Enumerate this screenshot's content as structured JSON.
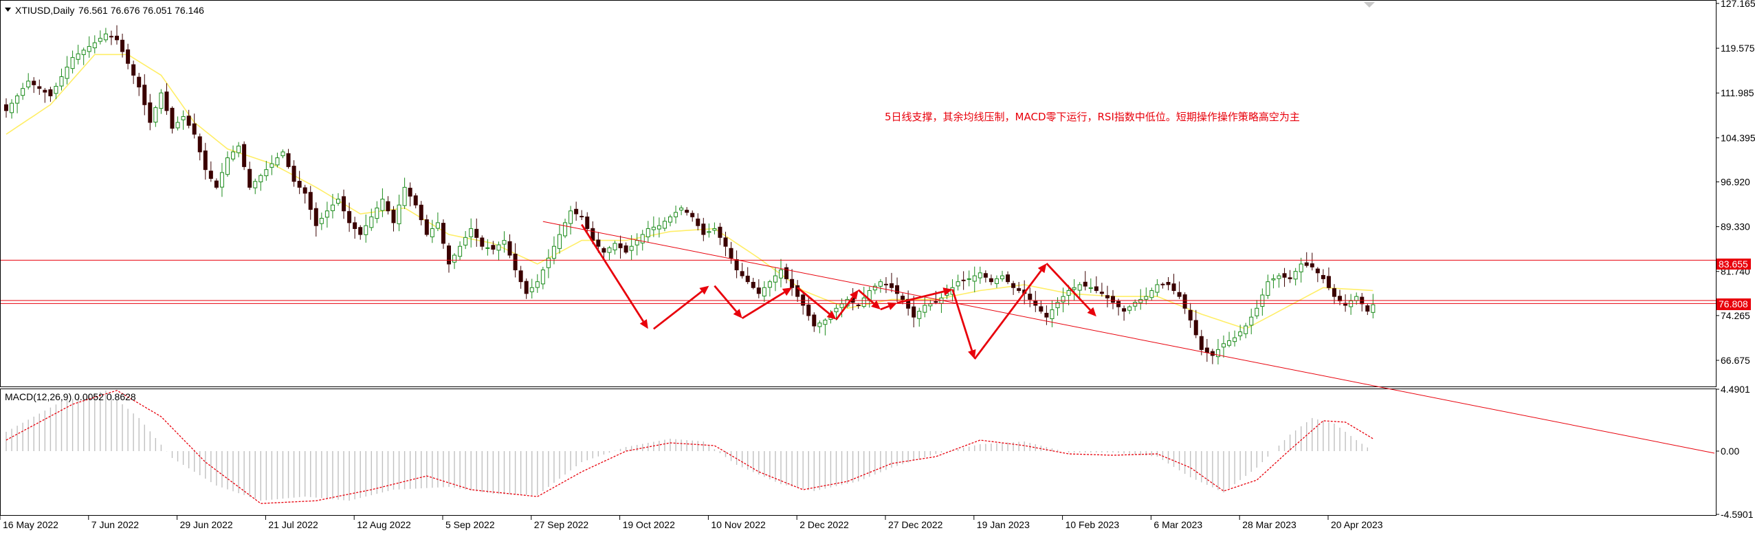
{
  "header": {
    "symbol_label": "XTIUSD,Daily",
    "ohlc_label": "76.561 76.676 76.051 76.146"
  },
  "annotation": "5日线支撑，其余均线压制，MACD零下运行，RSI指数中低位。短期操作操作策略高空为主",
  "macd": {
    "label": "MACD(12,26,9) 0.0052 0.8628",
    "ticks": [
      "4.4901",
      "0.00",
      "-4.5901"
    ],
    "tick_values": [
      4.4901,
      0,
      -4.5901
    ]
  },
  "colors": {
    "bull_candle": "#1a8a1a",
    "bear_candle": "#3a0000",
    "ma_line": "#ffee66",
    "red": "#e8000b",
    "grid_axis": "#000000",
    "macd_hist": "#c0c0c0"
  },
  "price_labels": {
    "resistance": "83.655",
    "current": "76.808"
  },
  "chart_data": {
    "type": "candlestick",
    "title": "XTIUSD,Daily",
    "y_ticks": [
      "127.165",
      "119.575",
      "111.985",
      "104.395",
      "96.920",
      "89.330",
      "81.740",
      "74.265",
      "66.675"
    ],
    "y_tick_values": [
      127.165,
      119.575,
      111.985,
      104.395,
      96.92,
      89.33,
      81.74,
      74.265,
      66.675
    ],
    "ylim": [
      62.5,
      127.2
    ],
    "x_ticks": [
      "16 May 2022",
      "7 Jun 2022",
      "29 Jun 2022",
      "21 Jul 2022",
      "12 Aug 2022",
      "5 Sep 2022",
      "27 Sep 2022",
      "19 Oct 2022",
      "10 Nov 2022",
      "2 Dec 2022",
      "27 Dec 2022",
      "19 Jan 2023",
      "10 Feb 2023",
      "6 Mar 2023",
      "28 Mar 2023",
      "20 Apr 2023"
    ],
    "x_tick_index": [
      0,
      16,
      32,
      48,
      64,
      80,
      96,
      112,
      128,
      144,
      160,
      176,
      192,
      208,
      224,
      240
    ],
    "close_anchors": [
      [
        0,
        109.0
      ],
      [
        4,
        114.0
      ],
      [
        8,
        111.5
      ],
      [
        12,
        118.0
      ],
      [
        16,
        120.5
      ],
      [
        18,
        122.0
      ],
      [
        20,
        121.0
      ],
      [
        22,
        117.0
      ],
      [
        24,
        113.0
      ],
      [
        26,
        107.0
      ],
      [
        28,
        112.0
      ],
      [
        30,
        106.0
      ],
      [
        32,
        108.0
      ],
      [
        34,
        105.0
      ],
      [
        36,
        99.0
      ],
      [
        38,
        96.0
      ],
      [
        40,
        101.0
      ],
      [
        42,
        103.0
      ],
      [
        44,
        96.0
      ],
      [
        46,
        98.0
      ],
      [
        48,
        100.0
      ],
      [
        50,
        102.0
      ],
      [
        52,
        97.0
      ],
      [
        54,
        95.0
      ],
      [
        56,
        89.5
      ],
      [
        58,
        92.0
      ],
      [
        60,
        94.0
      ],
      [
        62,
        90.0
      ],
      [
        64,
        88.0
      ],
      [
        66,
        91.0
      ],
      [
        68,
        94.0
      ],
      [
        70,
        90.0
      ],
      [
        72,
        96.0
      ],
      [
        74,
        93.0
      ],
      [
        76,
        88.0
      ],
      [
        78,
        90.0
      ],
      [
        80,
        83.0
      ],
      [
        82,
        86.0
      ],
      [
        84,
        89.0
      ],
      [
        86,
        86.0
      ],
      [
        88,
        85.5
      ],
      [
        90,
        87.0
      ],
      [
        92,
        82.0
      ],
      [
        94,
        78.0
      ],
      [
        96,
        80.0
      ],
      [
        98,
        84.0
      ],
      [
        100,
        88.0
      ],
      [
        102,
        92.0
      ],
      [
        104,
        91.0
      ],
      [
        106,
        87.0
      ],
      [
        108,
        85.0
      ],
      [
        110,
        86.5
      ],
      [
        112,
        85.0
      ],
      [
        114,
        87.0
      ],
      [
        116,
        89.0
      ],
      [
        118,
        89.5
      ],
      [
        120,
        91.0
      ],
      [
        122,
        92.5
      ],
      [
        124,
        91.0
      ],
      [
        126,
        88.0
      ],
      [
        128,
        89.0
      ],
      [
        130,
        86.0
      ],
      [
        132,
        82.0
      ],
      [
        134,
        80.0
      ],
      [
        136,
        78.0
      ],
      [
        138,
        80.0
      ],
      [
        140,
        82.0
      ],
      [
        142,
        79.0
      ],
      [
        144,
        76.0
      ],
      [
        146,
        72.5
      ],
      [
        148,
        73.5
      ],
      [
        150,
        75.5
      ],
      [
        152,
        77.0
      ],
      [
        154,
        76.0
      ],
      [
        156,
        78.5
      ],
      [
        158,
        80.0
      ],
      [
        160,
        79.0
      ],
      [
        162,
        77.0
      ],
      [
        164,
        74.0
      ],
      [
        166,
        76.0
      ],
      [
        168,
        76.5
      ],
      [
        170,
        78.0
      ],
      [
        172,
        80.0
      ],
      [
        174,
        80.5
      ],
      [
        176,
        81.5
      ],
      [
        178,
        80.0
      ],
      [
        180,
        81.0
      ],
      [
        182,
        79.0
      ],
      [
        184,
        78.0
      ],
      [
        186,
        76.0
      ],
      [
        188,
        74.0
      ],
      [
        190,
        76.5
      ],
      [
        192,
        78.5
      ],
      [
        194,
        79.5
      ],
      [
        196,
        79.0
      ],
      [
        198,
        78.0
      ],
      [
        200,
        76.5
      ],
      [
        202,
        75.0
      ],
      [
        204,
        76.5
      ],
      [
        206,
        77.5
      ],
      [
        208,
        79.5
      ],
      [
        210,
        79.5
      ],
      [
        212,
        77.5
      ],
      [
        214,
        73.5
      ],
      [
        216,
        68.5
      ],
      [
        218,
        67.5
      ],
      [
        220,
        69.5
      ],
      [
        222,
        70.5
      ],
      [
        224,
        72.5
      ],
      [
        226,
        75.5
      ],
      [
        228,
        80.0
      ],
      [
        230,
        81.0
      ],
      [
        232,
        80.5
      ],
      [
        234,
        83.0
      ],
      [
        236,
        82.5
      ],
      [
        238,
        80.5
      ],
      [
        240,
        77.5
      ],
      [
        242,
        76.0
      ],
      [
        244,
        77.5
      ],
      [
        246,
        75.0
      ],
      [
        247,
        76.1
      ]
    ],
    "ma_anchors": [
      [
        0,
        105.0
      ],
      [
        8,
        110.0
      ],
      [
        16,
        118.5
      ],
      [
        22,
        118.5
      ],
      [
        28,
        115.0
      ],
      [
        34,
        107.0
      ],
      [
        40,
        102.5
      ],
      [
        48,
        100.0
      ],
      [
        56,
        96.0
      ],
      [
        64,
        91.5
      ],
      [
        72,
        92.5
      ],
      [
        80,
        88.0
      ],
      [
        88,
        86.5
      ],
      [
        96,
        83.0
      ],
      [
        104,
        87.0
      ],
      [
        112,
        87.0
      ],
      [
        120,
        88.5
      ],
      [
        128,
        89.0
      ],
      [
        136,
        84.0
      ],
      [
        144,
        78.5
      ],
      [
        152,
        75.5
      ],
      [
        160,
        77.0
      ],
      [
        168,
        77.0
      ],
      [
        176,
        78.5
      ],
      [
        184,
        79.5
      ],
      [
        192,
        78.0
      ],
      [
        200,
        77.5
      ],
      [
        208,
        77.5
      ],
      [
        216,
        74.5
      ],
      [
        224,
        72.0
      ],
      [
        232,
        76.0
      ],
      [
        238,
        79.0
      ],
      [
        247,
        78.5
      ]
    ],
    "macd_hist_anchors": [
      [
        0,
        1.4
      ],
      [
        10,
        3.6
      ],
      [
        18,
        4.4
      ],
      [
        24,
        2.4
      ],
      [
        30,
        -0.5
      ],
      [
        38,
        -2.5
      ],
      [
        46,
        -3.6
      ],
      [
        54,
        -3.3
      ],
      [
        62,
        -3.6
      ],
      [
        70,
        -2.8
      ],
      [
        80,
        -2.6
      ],
      [
        88,
        -3.1
      ],
      [
        96,
        -3.2
      ],
      [
        104,
        -0.8
      ],
      [
        112,
        0.3
      ],
      [
        120,
        0.9
      ],
      [
        126,
        0.7
      ],
      [
        132,
        -1.0
      ],
      [
        140,
        -2.4
      ],
      [
        146,
        -2.9
      ],
      [
        154,
        -2.2
      ],
      [
        160,
        -1.2
      ],
      [
        168,
        -0.2
      ],
      [
        176,
        0.5
      ],
      [
        184,
        0.7
      ],
      [
        192,
        -0.1
      ],
      [
        200,
        -0.1
      ],
      [
        208,
        -0.4
      ],
      [
        214,
        -1.9
      ],
      [
        220,
        -3.0
      ],
      [
        226,
        -1.2
      ],
      [
        232,
        1.2
      ],
      [
        236,
        2.4
      ],
      [
        240,
        2.0
      ],
      [
        244,
        0.8
      ],
      [
        247,
        0.0
      ]
    ],
    "macd_signal_anchors": [
      [
        0,
        0.8
      ],
      [
        12,
        3.4
      ],
      [
        20,
        4.4
      ],
      [
        28,
        2.5
      ],
      [
        36,
        -0.8
      ],
      [
        46,
        -3.8
      ],
      [
        56,
        -3.6
      ],
      [
        66,
        -2.8
      ],
      [
        76,
        -1.8
      ],
      [
        84,
        -2.8
      ],
      [
        96,
        -3.3
      ],
      [
        104,
        -1.5
      ],
      [
        112,
        0.0
      ],
      [
        120,
        0.6
      ],
      [
        128,
        0.4
      ],
      [
        136,
        -1.5
      ],
      [
        144,
        -2.8
      ],
      [
        152,
        -2.2
      ],
      [
        160,
        -0.9
      ],
      [
        168,
        -0.4
      ],
      [
        176,
        0.8
      ],
      [
        184,
        0.4
      ],
      [
        192,
        -0.2
      ],
      [
        200,
        -0.3
      ],
      [
        208,
        -0.2
      ],
      [
        214,
        -1.2
      ],
      [
        220,
        -2.9
      ],
      [
        226,
        -2.1
      ],
      [
        232,
        0.1
      ],
      [
        238,
        2.2
      ],
      [
        242,
        2.1
      ],
      [
        247,
        0.9
      ]
    ],
    "trendline": [
      [
        97,
        90.2
      ],
      [
        248,
        62.2
      ]
    ],
    "horizontal_lines": [
      83.655,
      76.808,
      76.3
    ],
    "arrows": [
      [
        [
          104,
          89.7
        ],
        [
          116,
          72.0
        ]
      ],
      [
        [
          117,
          72.0
        ],
        [
          127,
          79.3
        ]
      ],
      [
        [
          128,
          79.3
        ],
        [
          133,
          73.8
        ]
      ],
      [
        [
          133,
          73.8
        ],
        [
          142,
          79.0
        ]
      ],
      [
        [
          143,
          79.0
        ],
        [
          150,
          73.6
        ]
      ],
      [
        [
          150,
          73.6
        ],
        [
          154,
          78.6
        ]
      ],
      [
        [
          154,
          78.6
        ],
        [
          158,
          75.3
        ]
      ],
      [
        [
          158,
          75.3
        ],
        [
          161,
          76.4
        ]
      ],
      [
        [
          161,
          76.4
        ],
        [
          171,
          78.7
        ]
      ],
      [
        [
          171,
          78.7
        ],
        [
          175,
          66.9
        ]
      ],
      [
        [
          175,
          66.9
        ],
        [
          188,
          83.1
        ]
      ],
      [
        [
          188,
          83.1
        ],
        [
          197,
          74.1
        ]
      ]
    ]
  }
}
